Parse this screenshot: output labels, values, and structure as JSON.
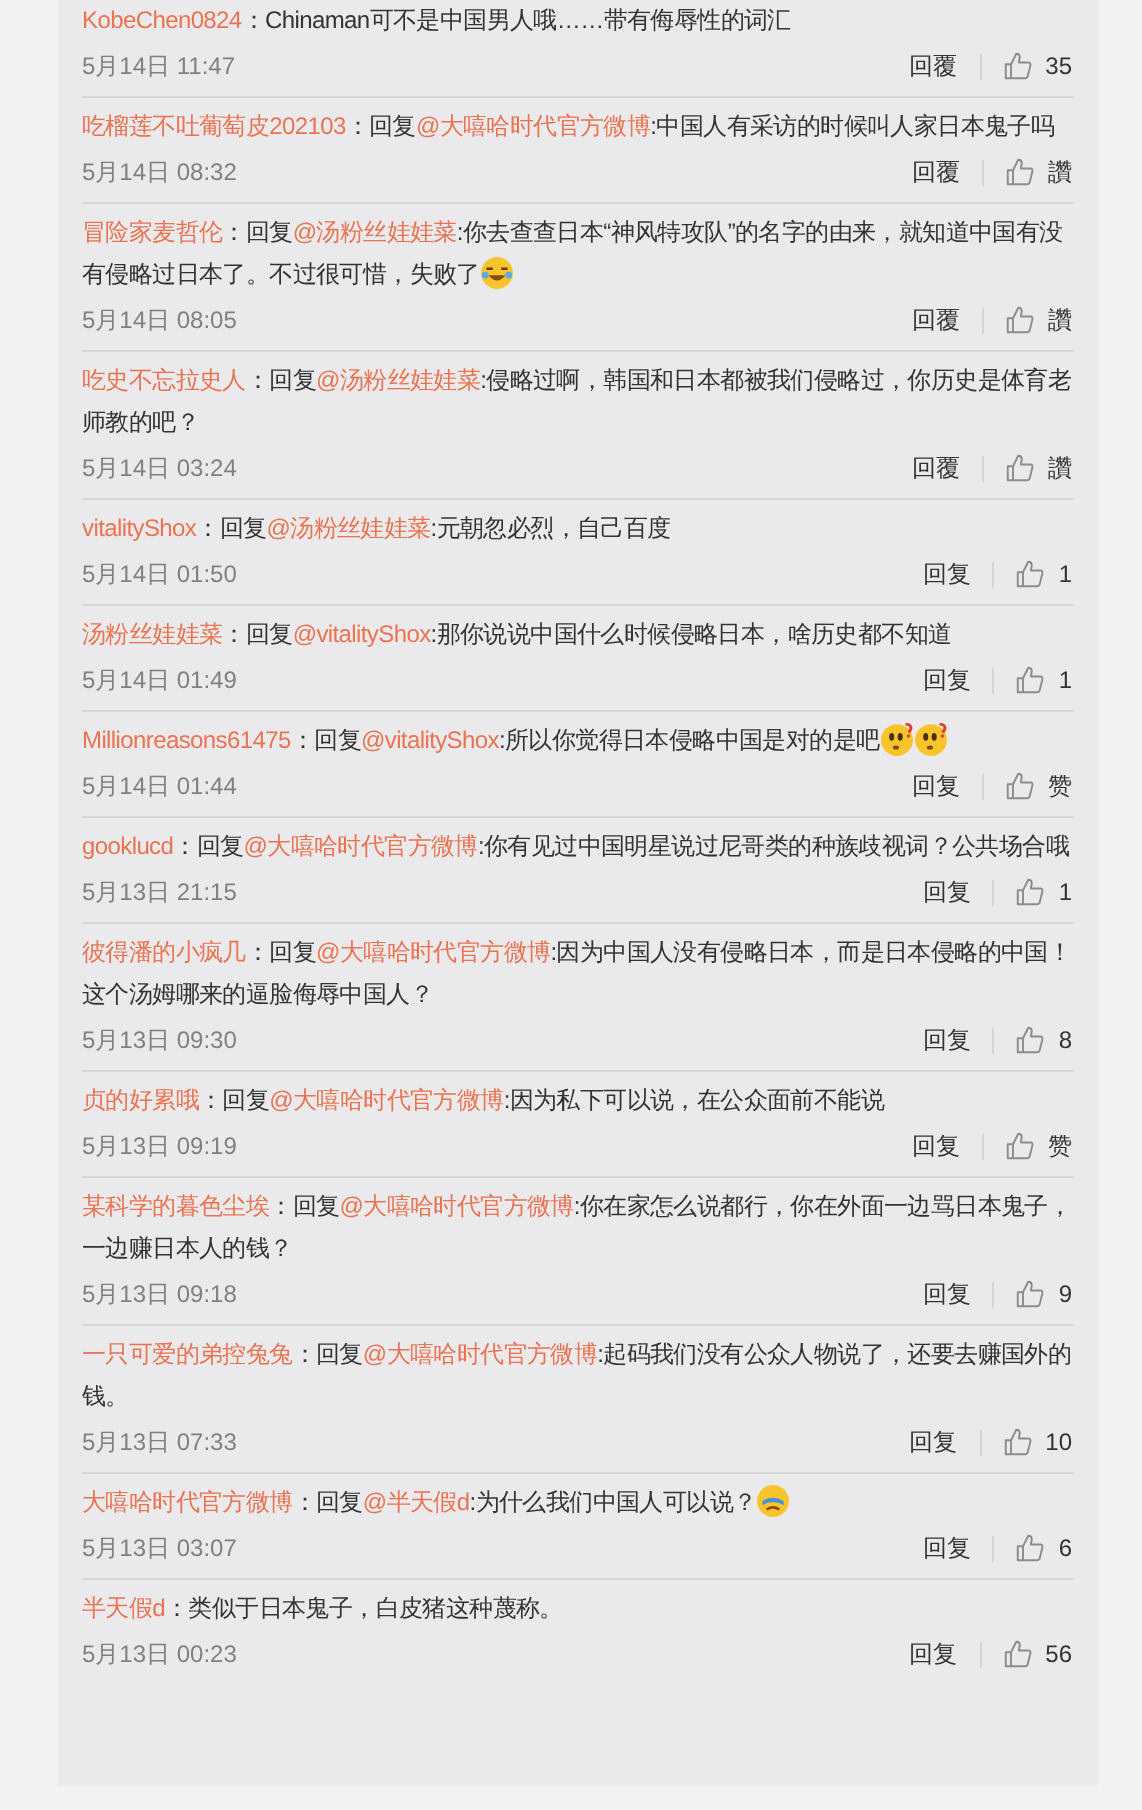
{
  "comments": [
    {
      "user": "KobeChen0824",
      "content": "：Chinaman可不是中国男人哦……带有侮辱性的词汇",
      "time": "5月14日 11:47",
      "reply_label": "回覆",
      "like_label": "35"
    },
    {
      "user": "吃榴莲不吐葡萄皮202103",
      "content": "：回复",
      "mention": "@大嘻哈时代官方微博",
      "text": ":中国人有采访的时候叫人家日本鬼子吗",
      "time": "5月14日 08:32",
      "reply_label": "回覆",
      "like_label": "讚"
    },
    {
      "user": "冒险家麦哲伦",
      "content": "：回复",
      "mention": "@汤粉丝娃娃菜",
      "text": ":你去查查日本“神风特攻队”的名字的由来，就知道中国有没有侵略过日本了。不过很可惜，失败了",
      "emojis": [
        {
          "kind": "laugh-cry"
        }
      ],
      "time": "5月14日 08:05",
      "reply_label": "回覆",
      "like_label": "讚"
    },
    {
      "user": "吃史不忘拉史人",
      "content": "：回复",
      "mention": "@汤粉丝娃娃菜",
      "text": ":侵略过啊，韩国和日本都被我们侵略过，你历史是体育老师教的吧？",
      "time": "5月14日 03:24",
      "reply_label": "回覆",
      "like_label": "讚"
    },
    {
      "user": "vitalityShox",
      "content": "：回复",
      "mention": "@汤粉丝娃娃菜",
      "text": ":元朝忽必烈，自己百度",
      "time": "5月14日 01:50",
      "reply_label": "回复",
      "like_label": "1"
    },
    {
      "user": "汤粉丝娃娃菜",
      "content": "：回复",
      "mention": "@vitalityShox",
      "text": ":那你说说中国什么时候侵略日本，啥历史都不知道",
      "time": "5月14日 01:49",
      "reply_label": "回复",
      "like_label": "1"
    },
    {
      "user": "Millionreasons61475",
      "content": "：回复",
      "mention": "@vitalityShox",
      "text": ":所以你觉得日本侵略中国是对的是吧",
      "emojis": [
        {
          "kind": "puzzled"
        },
        {
          "kind": "puzzled"
        }
      ],
      "time": "5月14日 01:44",
      "reply_label": "回复",
      "like_label": "赞"
    },
    {
      "user": "gooklucd",
      "content": "：回复",
      "mention": "@大嘻哈时代官方微博",
      "text": ":你有见过中国明星说过尼哥类的种族歧视词？公共场合哦",
      "time": "5月13日 21:15",
      "reply_label": "回复",
      "like_label": "1"
    },
    {
      "user": "彼得潘的小疯几",
      "content": "：回复",
      "mention": "@大嘻哈时代官方微博",
      "text": ":因为中国人没有侵略日本，而是日本侵略的中国！这个汤姆哪来的逼脸侮辱中国人？",
      "time": "5月13日 09:30",
      "reply_label": "回复",
      "like_label": "8"
    },
    {
      "user": "贞的好累哦",
      "content": "：回复",
      "mention": "@大嘻哈时代官方微博",
      "text": ":因为私下可以说，在公众面前不能说",
      "time": "5月13日 09:19",
      "reply_label": "回复",
      "like_label": "赞"
    },
    {
      "user": "某科学的暮色尘埃",
      "content": "：回复",
      "mention": "@大嘻哈时代官方微博",
      "text": ":你在家怎么说都行，你在外面一边骂日本鬼子，一边赚日本人的钱？",
      "time": "5月13日 09:18",
      "reply_label": "回复",
      "like_label": "9"
    },
    {
      "user": "一只可爱的弟控兔兔",
      "content": "：回复",
      "mention": "@大嘻哈时代官方微博",
      "text": ":起码我们没有公众人物说了，还要去赚国外的钱。",
      "time": "5月13日 07:33",
      "reply_label": "回复",
      "like_label": "10"
    },
    {
      "user": "大嘻哈时代官方微博",
      "content": "：回复",
      "mention": "@半天假d",
      "text": ":为什么我们中国人可以说？",
      "emojis": [
        {
          "kind": "tears"
        }
      ],
      "time": "5月13日 03:07",
      "reply_label": "回复",
      "like_label": "6"
    },
    {
      "user": "半天假d",
      "content": "：类似于日本鬼子，白皮猪这种蔑称。",
      "time": "5月13日 00:23",
      "reply_label": "回复",
      "like_label": "56"
    }
  ]
}
